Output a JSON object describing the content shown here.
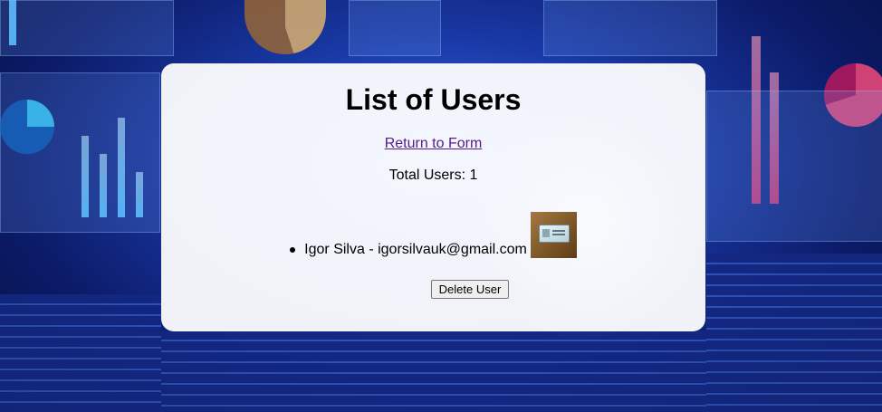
{
  "page": {
    "title": "List of Users",
    "return_link": "Return to Form",
    "total_users": "Total Users: 1"
  },
  "users": [
    {
      "entry": "Igor Silva - igorsilvauk@gmail.com",
      "photo_icon": "id-card-photo"
    }
  ],
  "actions": {
    "delete_label": "Delete User"
  }
}
